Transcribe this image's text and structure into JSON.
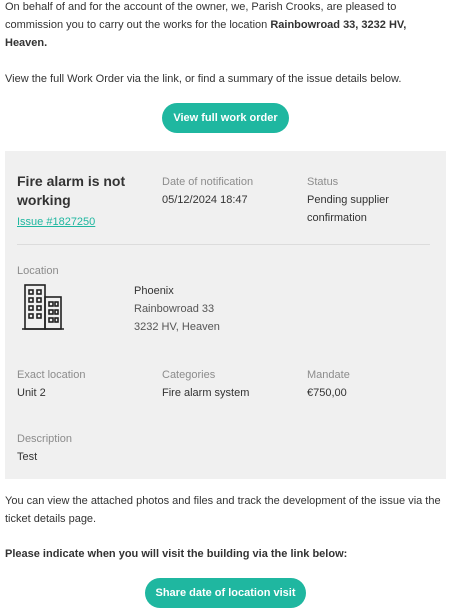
{
  "intro": {
    "text_before": "On behalf of and for the account of the owner, we, Parish Crooks, are pleased to commission you to carry out the works for the location ",
    "address_bold": "Rainbowroad 33, 3232 HV, Heaven."
  },
  "view_text": "View the full Work Order via the link, or find a summary of the issue details below.",
  "view_button_label": "View full work order",
  "issue": {
    "title": "Fire alarm is not working",
    "number_link": "Issue #1827250",
    "date_label": "Date of notification",
    "date_value": "05/12/2024 18:47",
    "status_label": "Status",
    "status_value": "Pending supplier confirmation",
    "location_label": "Location",
    "location_name": "Phoenix",
    "location_street": "Rainbowroad 33",
    "location_city": "3232 HV, Heaven",
    "exact_location_label": "Exact location",
    "exact_location_value": "Unit 2",
    "categories_label": "Categories",
    "categories_value": "Fire alarm system",
    "mandate_label": "Mandate",
    "mandate_value": "€750,00",
    "description_label": "Description",
    "description_value": "Test",
    "building_icon": "building-icon"
  },
  "photos_text": "You can view the attached photos and files and track the development of the issue via the ticket details page.",
  "visit_prompt": "Please indicate when you will visit the building via the link below:",
  "visit_button_label": "Share date of location visit",
  "colors": {
    "accent": "#1fb7a0",
    "card_bg": "#f0f0f0",
    "label": "#8c8c8c",
    "text": "#333333"
  }
}
